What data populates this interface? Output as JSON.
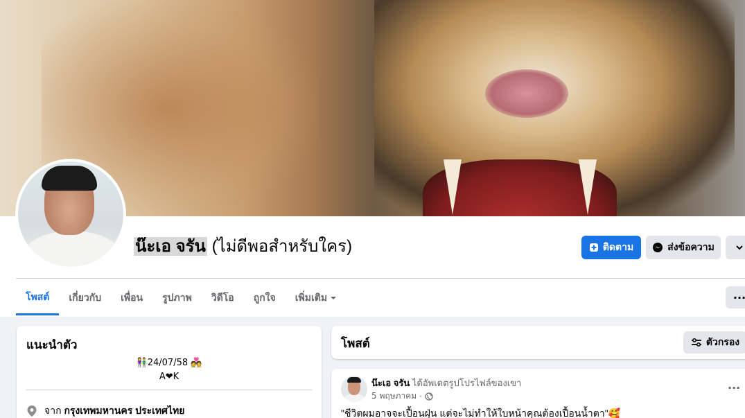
{
  "profile": {
    "name": "น๊ะเอ จรัน",
    "nickname": "(ไม่ดีพอสำหรับใคร)",
    "follow_label": "ติดตาม",
    "message_label": "ส่งข้อความ",
    "more_label": "⌄"
  },
  "tabs": [
    {
      "label": "โพสต์"
    },
    {
      "label": "เกี่ยวกับ"
    },
    {
      "label": "เพื่อน"
    },
    {
      "label": "รูปภาพ"
    },
    {
      "label": "วิดีโอ"
    },
    {
      "label": "ถูกใจ"
    },
    {
      "label": "เพิ่มเติม"
    }
  ],
  "tab_more_dots": "···",
  "intro": {
    "title": "แนะนำตัว",
    "bio_line1": "👫24/07/58 💑",
    "bio_line2": "A❤K",
    "location_prefix": "จาก",
    "location": "กรุงเทพมหานคร ประเทศไทย"
  },
  "posts": {
    "title": "โพสต์",
    "filter_label": "ตัวกรอง"
  },
  "post": {
    "author": "น๊ะเอ จรัน",
    "action": "ได้อัพเดตรูปโปรไฟล์ของเขา",
    "date": "5 พฤษภาคม",
    "dot": "·",
    "text": "\"ชีวิตผมอาจจะเปื้อนฝุ่น แต่จะไม่ทำให้ใบหน้าคุณต้องเปื้อนน้ำตา\"🥰",
    "menu": "···"
  },
  "colors": {
    "accent": "#1b74e4",
    "background": "#f0f2f5",
    "secondary_button": "#e4e6eb",
    "muted_text": "#65676b"
  }
}
